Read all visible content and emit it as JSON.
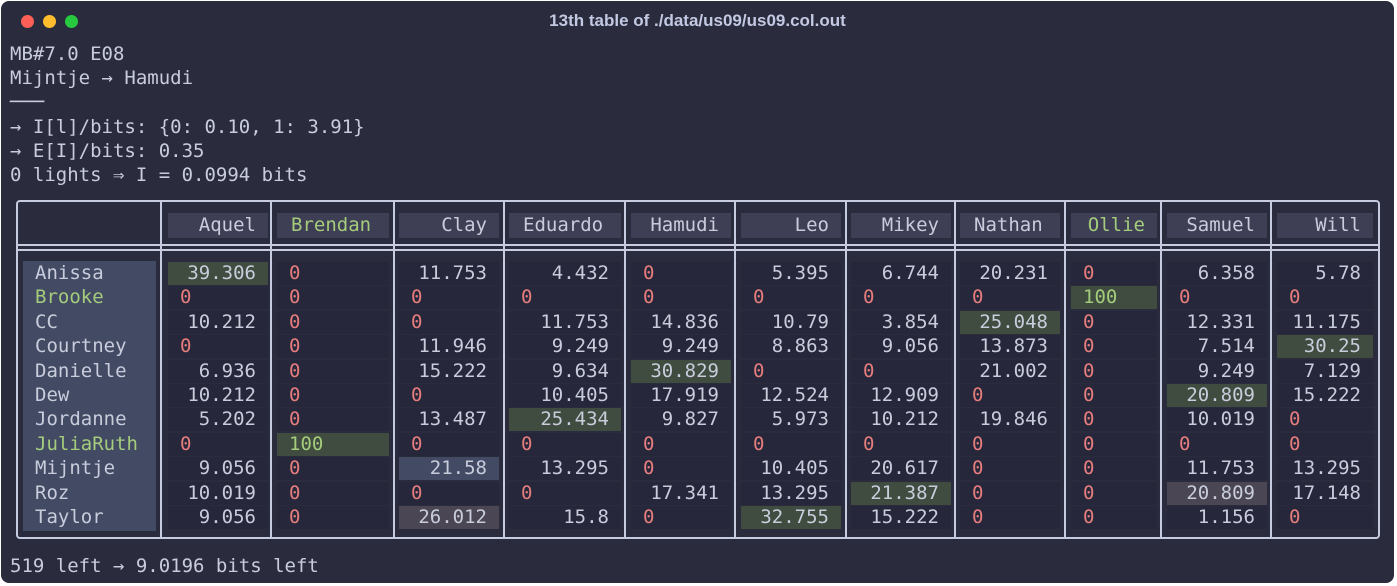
{
  "window": {
    "title": "13th table of ./data/us09/us09.col.out"
  },
  "terminal": {
    "lines": [
      "MB#7.0 E08",
      "Mijntje → Hamudi",
      "───",
      "→ I[l]/bits: {0: 0.10, 1: 3.91}",
      "→ E[I]/bits: 0.35",
      "0 lights ⇒ I = 0.0994 bits"
    ],
    "footer": "519 left → 9.0196 bits left"
  },
  "table": {
    "columns": [
      "Aquel",
      "Brendan",
      "Clay",
      "Eduardo",
      "Hamudi",
      "Leo",
      "Mikey",
      "Nathan",
      "Ollie",
      "Samuel",
      "Will"
    ],
    "highlighted_columns": [
      "Brendan",
      "Ollie"
    ],
    "rows": [
      {
        "name": "Anissa",
        "cells": [
          "39.306",
          "0",
          "11.753",
          "4.432",
          "0",
          "5.395",
          "6.744",
          "20.231",
          "0",
          "6.358",
          "5.78"
        ]
      },
      {
        "name": "Brooke",
        "cells": [
          "0",
          "0",
          "0",
          "0",
          "0",
          "0",
          "0",
          "0",
          "100",
          "0",
          "0"
        ]
      },
      {
        "name": "CC",
        "cells": [
          "10.212",
          "0",
          "0",
          "11.753",
          "14.836",
          "10.79",
          "3.854",
          "25.048",
          "0",
          "12.331",
          "11.175"
        ]
      },
      {
        "name": "Courtney",
        "cells": [
          "0",
          "0",
          "11.946",
          "9.249",
          "9.249",
          "8.863",
          "9.056",
          "13.873",
          "0",
          "7.514",
          "30.25"
        ]
      },
      {
        "name": "Danielle",
        "cells": [
          "6.936",
          "0",
          "15.222",
          "9.634",
          "30.829",
          "0",
          "0",
          "21.002",
          "0",
          "9.249",
          "7.129"
        ]
      },
      {
        "name": "Dew",
        "cells": [
          "10.212",
          "0",
          "0",
          "10.405",
          "17.919",
          "12.524",
          "12.909",
          "0",
          "0",
          "20.809",
          "15.222"
        ]
      },
      {
        "name": "Jordanne",
        "cells": [
          "5.202",
          "0",
          "13.487",
          "25.434",
          "9.827",
          "5.973",
          "10.212",
          "19.846",
          "0",
          "10.019",
          "0"
        ]
      },
      {
        "name": "JuliaRuth",
        "cells": [
          "0",
          "100",
          "0",
          "0",
          "0",
          "0",
          "0",
          "0",
          "0",
          "0",
          "0"
        ]
      },
      {
        "name": "Mijntje",
        "cells": [
          "9.056",
          "0",
          "21.58",
          "13.295",
          "0",
          "10.405",
          "20.617",
          "0",
          "0",
          "11.753",
          "13.295"
        ]
      },
      {
        "name": "Roz",
        "cells": [
          "10.019",
          "0",
          "0",
          "0",
          "17.341",
          "13.295",
          "21.387",
          "0",
          "0",
          "20.809",
          "17.148"
        ]
      },
      {
        "name": "Taylor",
        "cells": [
          "9.056",
          "0",
          "26.012",
          "15.8",
          "0",
          "32.755",
          "15.222",
          "0",
          "0",
          "1.156",
          "0"
        ]
      }
    ],
    "highlighted_rows": [
      "Brooke",
      "JuliaRuth"
    ],
    "colors": {
      "background": "#2a2c3d",
      "text": "#c8ccdb",
      "zero": "#e67d7d",
      "green": "#a4cc7c",
      "highlight_green": "#3f4c3f",
      "highlight_blue": "#424a64",
      "highlight_grey": "#4a4654"
    }
  }
}
